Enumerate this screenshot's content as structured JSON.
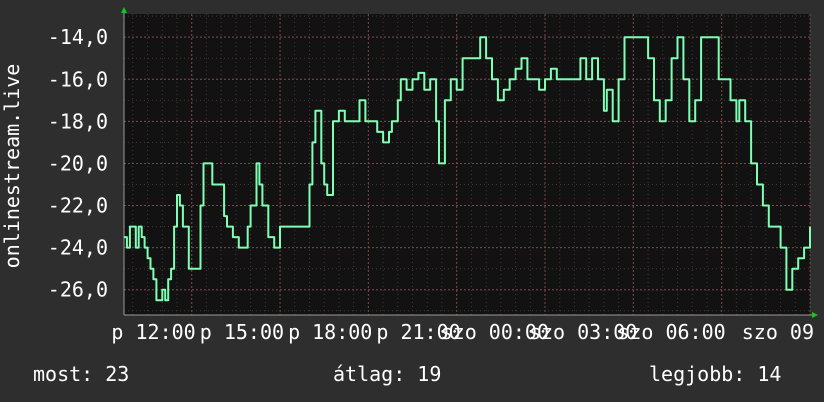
{
  "chart_data": {
    "type": "line",
    "ylabel": "onlinestream.live",
    "ylim": [
      -27.2,
      -12.9
    ],
    "yticks": [
      "-14,0",
      "-16,0",
      "-18,0",
      "-20,0",
      "-22,0",
      "-24,0",
      "-26,0"
    ],
    "ytick_values": [
      -14,
      -16,
      -18,
      -20,
      -22,
      -24,
      -26
    ],
    "xlim_hours": [
      9.7,
      33.0
    ],
    "xticks": [
      "p 12:00",
      "p 15:00",
      "p 18:00",
      "p 21:00",
      "szo 00:00",
      "szo 03:00",
      "szo 06:00",
      "szo 09"
    ],
    "xtick_hours": [
      12,
      15,
      18,
      21,
      24,
      27,
      30,
      33
    ],
    "grid": true,
    "line_color": "#7fffb4",
    "series": [
      {
        "x": [
          9.7,
          9.8,
          9.9,
          10.0,
          10.1,
          10.2,
          10.3,
          10.4,
          10.5,
          10.6,
          10.7,
          10.8,
          11.0,
          11.1,
          11.2,
          11.3,
          11.4,
          11.5,
          11.6,
          11.7,
          11.9,
          12.0,
          12.1,
          12.2,
          12.3,
          12.4,
          12.5,
          12.6,
          12.7,
          12.8,
          13.0,
          13.1,
          13.2,
          13.4,
          13.6,
          13.8,
          13.9,
          14.0,
          14.2,
          14.3,
          14.4,
          14.6,
          14.8,
          14.9,
          15.0,
          15.1,
          15.2,
          15.3,
          15.4,
          15.6,
          15.8,
          16.0,
          16.1,
          16.2,
          16.4,
          16.5,
          16.6,
          16.8,
          16.9,
          17.0,
          17.1,
          17.2,
          17.3,
          17.5,
          17.7,
          17.9,
          18.1,
          18.3,
          18.5,
          18.7,
          18.8,
          19.0,
          19.1,
          19.3,
          19.5,
          19.7,
          19.9,
          20.1,
          20.3,
          20.4,
          20.6,
          20.8,
          21.0,
          21.2,
          21.4,
          21.6,
          21.8,
          22.0,
          22.2,
          22.4,
          22.6,
          22.8,
          23.0,
          23.2,
          23.4,
          23.6,
          23.8,
          24.0,
          24.2,
          24.4,
          24.6,
          24.8,
          25.0,
          25.2,
          25.4,
          25.6,
          25.8,
          26.0,
          26.1,
          26.3,
          26.5,
          26.7,
          26.9,
          27.1,
          27.3,
          27.5,
          27.7,
          27.9,
          28.1,
          28.3,
          28.5,
          28.7,
          28.9,
          29.1,
          29.3,
          29.5,
          29.7,
          29.9,
          30.1,
          30.3,
          30.5,
          30.6,
          30.8,
          31.0,
          31.2,
          31.4,
          31.6,
          31.8,
          32.0,
          32.2,
          32.4,
          32.6,
          32.8,
          33.0
        ],
        "values": [
          -23.5,
          -24.0,
          -23.0,
          -23.0,
          -24.0,
          -23.0,
          -23.5,
          -24.0,
          -24.5,
          -25.0,
          -25.5,
          -26.5,
          -26.0,
          -26.5,
          -25.5,
          -25.0,
          -23.0,
          -21.5,
          -22.0,
          -23.0,
          -25.0,
          -25.0,
          -25.0,
          -25.0,
          -22.0,
          -20.0,
          -20.0,
          -20.0,
          -21.0,
          -21.0,
          -21.0,
          -22.5,
          -23.0,
          -23.5,
          -24.0,
          -24.0,
          -23.0,
          -22.0,
          -20.0,
          -21.0,
          -22.0,
          -23.5,
          -24.0,
          -24.0,
          -23.0,
          -23.0,
          -23.0,
          -23.0,
          -23.0,
          -23.0,
          -23.0,
          -21.0,
          -19.0,
          -17.5,
          -20.0,
          -21.0,
          -21.5,
          -18.0,
          -18.0,
          -17.5,
          -17.5,
          -18.0,
          -18.0,
          -18.0,
          -17.0,
          -18.0,
          -18.0,
          -18.5,
          -19.0,
          -18.5,
          -18.0,
          -17.0,
          -16.0,
          -16.5,
          -16.0,
          -15.7,
          -16.5,
          -16.0,
          -18.0,
          -20.0,
          -17.0,
          -16.0,
          -16.5,
          -15.0,
          -15.0,
          -15.0,
          -14.0,
          -15.0,
          -16.0,
          -17.0,
          -16.5,
          -16.0,
          -15.5,
          -15.0,
          -16.0,
          -16.0,
          -16.5,
          -16.0,
          -15.5,
          -16.0,
          -16.0,
          -16.0,
          -16.0,
          -15.0,
          -16.0,
          -15.0,
          -16.0,
          -17.5,
          -16.5,
          -18.0,
          -16.0,
          -14.0,
          -14.0,
          -14.0,
          -14.0,
          -15.0,
          -17.0,
          -18.0,
          -17.0,
          -15.0,
          -14.0,
          -16.0,
          -18.0,
          -17.0,
          -14.0,
          -14.0,
          -14.0,
          -16.0,
          -16.0,
          -17.0,
          -18.0,
          -17.0,
          -18.0,
          -20.0,
          -21.0,
          -22.0,
          -23.0,
          -23.0,
          -24.0,
          -26.0,
          -25.0,
          -24.5,
          -24.0,
          -23.0
        ]
      }
    ]
  },
  "footer": {
    "current_label": "most: 23",
    "average_label": "átlag: 19",
    "best_label": "legjobb: 14"
  }
}
